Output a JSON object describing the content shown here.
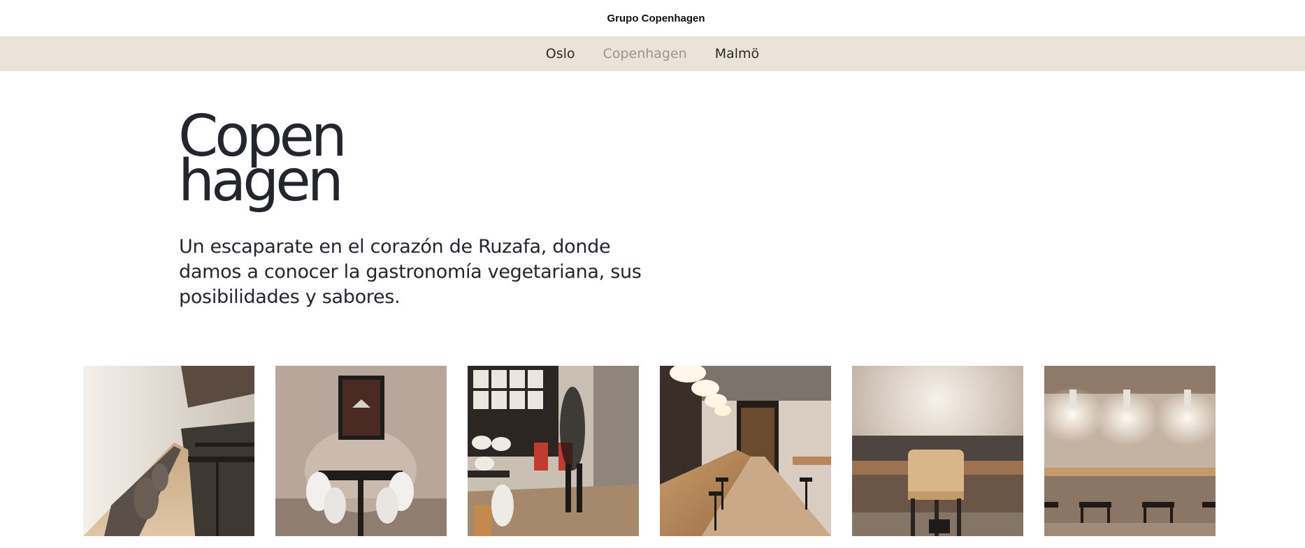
{
  "header": {
    "brand": "Grupo Copenhagen"
  },
  "nav": {
    "items": [
      {
        "label": "Oslo",
        "active": false
      },
      {
        "label": "Copenhagen",
        "active": true
      },
      {
        "label": "Malmö",
        "active": false
      }
    ]
  },
  "hero": {
    "title_line1": "Copen",
    "title_line2": "hagen",
    "description": "Un escaparate en el corazón de Ruzafa, donde damos a conocer la gastronomía vegetariana, sus posibilidades y sabores."
  },
  "gallery": {
    "photos": [
      {
        "subject": "long-bench-dining-room"
      },
      {
        "subject": "table-with-poster"
      },
      {
        "subject": "dining-room-with-waiter"
      },
      {
        "subject": "long-wooden-bar-with-pendants"
      },
      {
        "subject": "bench-with-chair"
      },
      {
        "subject": "wall-lights-counter"
      }
    ]
  },
  "colors": {
    "navbar_bg": "#ebe3d8",
    "nav_active": "#9a9591",
    "text_dark": "#23262d"
  }
}
